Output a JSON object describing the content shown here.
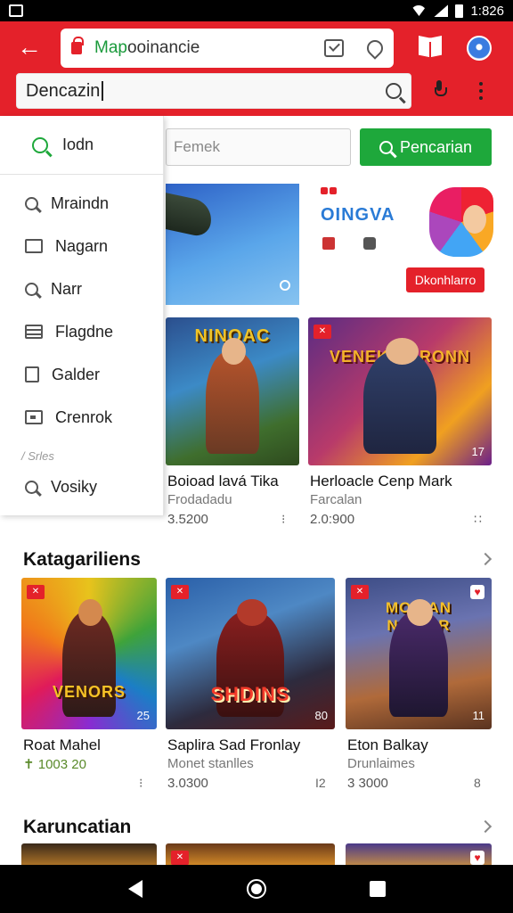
{
  "status_bar": {
    "time": "1:826"
  },
  "toolbar": {
    "url": "Mapooinancie",
    "search_value": "Dencazin"
  },
  "filter": {
    "placeholder": "Femek",
    "search_button_label": "Pencarian"
  },
  "banner": {
    "title": "OINGVA",
    "download_label": "Dkonhlarro"
  },
  "side_menu": {
    "header_label": "Iodn",
    "items": [
      {
        "icon": "search-icon",
        "label": "Mraindn"
      },
      {
        "icon": "window-icon",
        "label": "Nagarn"
      },
      {
        "icon": "search-icon",
        "label": "Narr"
      },
      {
        "icon": "list-icon",
        "label": "Flagdne"
      },
      {
        "icon": "page-icon",
        "label": "Galder"
      },
      {
        "icon": "chat-icon",
        "label": "Crenrok"
      }
    ],
    "section_label": "Srles",
    "footer_item": {
      "icon": "search-icon",
      "label": "Vosiky"
    }
  },
  "featured_games": [
    {
      "art_title": "NINOAC",
      "title": "Boioad lavá Tika",
      "subtitle": "Frodadadu",
      "count": "3.5200",
      "more": "⁝",
      "corner": ""
    },
    {
      "art_title": "VENEK DARONN",
      "title": "Herloacle Cenp Mark",
      "subtitle": "Farcalan",
      "count": "2.0:900",
      "more": "∷",
      "corner": "17"
    }
  ],
  "sections": [
    {
      "title": "Katagariliens",
      "games": [
        {
          "art_title": "VENORS",
          "title": "Roat Mahel",
          "subtitle": "✝ 1003 20",
          "count": "",
          "more": "⁝",
          "corner": "25"
        },
        {
          "art_title": "SHDINS",
          "title": "Saplira Sad Fronlay",
          "subtitle": "Monet stanlles",
          "count": "3.0300",
          "more": "I2",
          "corner": "80"
        },
        {
          "art_title": "MOVIAN NOVIER",
          "title": "Eton Balkay",
          "subtitle": "Drunlaimes",
          "count": "3 3000",
          "more": "8",
          "corner": "11"
        }
      ]
    },
    {
      "title": "Karuncatian",
      "games": []
    }
  ]
}
